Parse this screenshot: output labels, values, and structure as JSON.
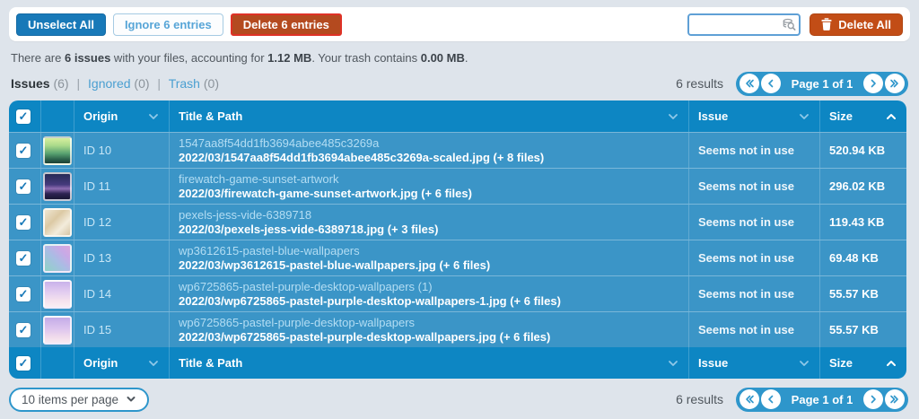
{
  "toolbar": {
    "unselect_all_label": "Unselect All",
    "ignore_label": "Ignore 6 entries",
    "delete_entries_label": "Delete 6 entries",
    "search_value": "",
    "delete_all_label": "Delete All"
  },
  "summary": {
    "t1": "There are ",
    "b1": "6 issues",
    "t2": " with your files, accounting for ",
    "b2": "1.12 MB",
    "t3": ". Your trash contains ",
    "b3": "0.00 MB",
    "t4": "."
  },
  "tabs": {
    "issues_label": "Issues",
    "issues_count": "(6)",
    "ignored_label": "Ignored",
    "ignored_count": "(0)",
    "trash_label": "Trash",
    "trash_count": "(0)",
    "separator": "|"
  },
  "pagination": {
    "results_text": "6 results",
    "page_text": "Page 1 of 1"
  },
  "table": {
    "headers": {
      "origin": "Origin",
      "title_path": "Title & Path",
      "issue": "Issue",
      "size": "Size"
    },
    "rows": [
      {
        "id": "ID 10",
        "title": "1547aa8f54dd1fb3694abee485c3269a",
        "path": "2022/03/1547aa8f54dd1fb3694abee485c3269a-scaled.jpg (+ 8 files)",
        "issue": "Seems not in use",
        "size": "520.94 KB",
        "thumb_style": "background:linear-gradient(180deg,#d8ef9e 0%,#a9d98a 30%,#56a06f 62%,#2a5f4a 85%,#1d4034 100%)"
      },
      {
        "id": "ID 11",
        "title": "firewatch-game-sunset-artwork",
        "path": "2022/03/firewatch-game-sunset-artwork.jpg (+ 6 files)",
        "issue": "Seems not in use",
        "size": "296.02 KB",
        "thumb_style": "background:linear-gradient(180deg,#272b57 0%,#453a7c 42%,#8e6cb2 58%,#2d2452 78%,#181634 100%)"
      },
      {
        "id": "ID 12",
        "title": "pexels-jess-vide-6389718",
        "path": "2022/03/pexels-jess-vide-6389718.jpg (+ 3 files)",
        "issue": "Seems not in use",
        "size": "119.43 KB",
        "thumb_style": "background:linear-gradient(135deg,#efe6d3 0%,#dcc9a4 38%,#f3ecdc 68%,#d7c6a5 100%)"
      },
      {
        "id": "ID 13",
        "title": "wp3612615-pastel-blue-wallpapers",
        "path": "2022/03/wp3612615-pastel-blue-wallpapers.jpg (+ 6 files)",
        "issue": "Seems not in use",
        "size": "69.48 KB",
        "thumb_style": "background:linear-gradient(45deg,#8ed3c6 0%,#a9bde4 45%,#c9a9e6 75%,#d9a8dd 100%)"
      },
      {
        "id": "ID 14",
        "title": "wp6725865-pastel-purple-desktop-wallpapers (1)",
        "path": "2022/03/wp6725865-pastel-purple-desktop-wallpapers-1.jpg (+ 6 files)",
        "issue": "Seems not in use",
        "size": "55.57 KB",
        "thumb_style": "background:linear-gradient(180deg,#c9b2ea 0%,#e2ccf0 40%,#f5e2ee 75%,#faeef3 100%)"
      },
      {
        "id": "ID 15",
        "title": "wp6725865-pastel-purple-desktop-wallpapers",
        "path": "2022/03/wp6725865-pastel-purple-desktop-wallpapers.jpg (+ 6 files)",
        "issue": "Seems not in use",
        "size": "55.57 KB",
        "thumb_style": "background:linear-gradient(180deg,#c4ace8 0%,#ddc5ee 45%,#f2ddec 80%,#f8eaf0 100%)"
      }
    ]
  },
  "footer": {
    "items_per_page_label": "10 items per page"
  },
  "colors": {
    "page_bg": "#dee4eb",
    "table_header_blue": "#0d86c3",
    "row_blue": "#3b95c7",
    "accent_blue": "#1879b8",
    "pager_blue": "#2e96cb",
    "danger_red": "#b44a1f",
    "danger_border": "#df3126",
    "link_light_blue": "#b3ddf3"
  },
  "icons": {
    "search": "magnifier-database",
    "delete_all": "trash-can",
    "sort_desc": "chevron-down",
    "sort_asc": "chevron-up",
    "checkbox": "check-mark",
    "pagination_first": "double-chevron-left",
    "pagination_prev": "chevron-left",
    "pagination_next": "chevron-right",
    "pagination_last": "double-chevron-right",
    "items_per_page": "chevron-down"
  }
}
